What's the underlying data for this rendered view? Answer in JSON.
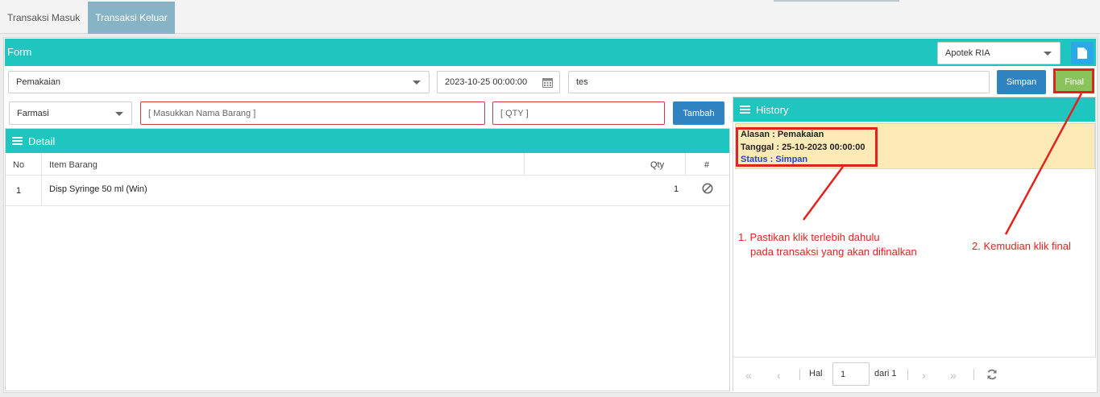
{
  "tabs": [
    {
      "label": "Transaksi Masuk",
      "active": false
    },
    {
      "label": "Transaksi Keluar",
      "active": true
    }
  ],
  "form": {
    "title": "Form",
    "apotek_select": "Apotek RIA",
    "document_icon": "document-icon",
    "reason_select": "Pemakaian",
    "date_value": "2023-10-25 00:00:00",
    "calendar_icon": "calendar-icon",
    "note_value": "tes",
    "save_label": "Simpan",
    "final_label": "Final"
  },
  "item_entry": {
    "category_select": "Farmasi",
    "item_placeholder": "[ Masukkan Nama Barang ]",
    "qty_placeholder": "[ QTY ]",
    "add_label": "Tambah"
  },
  "detail": {
    "title": "Detail",
    "columns": [
      "No",
      "Item Barang",
      "Qty",
      "#"
    ],
    "rows": [
      {
        "no": "1",
        "item": "Disp Syringe 50 ml (Win)",
        "qty": "1",
        "action_icon": "cancel-icon"
      }
    ]
  },
  "history": {
    "title": "History",
    "entries": [
      {
        "alasan": "Alasan : Pemakaian",
        "tanggal": "Tanggal : 25-10-2023 00:00:00",
        "status": "Status : Simpan"
      }
    ],
    "pager": {
      "page_label": "Hal",
      "page_value": "1",
      "of_label": "dari 1"
    }
  },
  "annotations": {
    "note1_line1": "1. Pastikan klik terlebih dahulu",
    "note1_line2": "pada transaksi yang akan difinalkan",
    "note2": "2. Kemudian klik final"
  },
  "colors": {
    "teal_header": "#1ec6bf",
    "active_tab": "#86b4c5",
    "primary_button": "#3083c1",
    "final_button": "#8ac35b",
    "annotation_red": "#e0231c",
    "history_card": "#fdeab6"
  }
}
